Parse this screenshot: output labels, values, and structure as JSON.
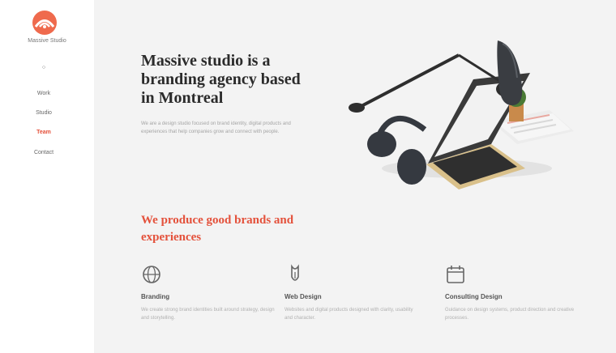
{
  "sidebar": {
    "brand": "Massive Studio",
    "nav": [
      {
        "label": "",
        "active": false
      },
      {
        "label": "Work",
        "active": false
      },
      {
        "label": "Studio",
        "active": false
      },
      {
        "label": "Team",
        "active": true
      },
      {
        "label": "Contact",
        "active": false
      }
    ],
    "accent_color": "#e4513b"
  },
  "hero": {
    "title": "Massive studio is a branding agency based in Montreal",
    "description": "We are a design studio focused on brand identity, digital products and experiences that help companies grow and connect with people."
  },
  "tagline": "We produce good brands and experiences",
  "services": [
    {
      "icon": "globe-icon",
      "name": "Branding",
      "desc": "We create strong brand identities built around strategy, design and storytelling."
    },
    {
      "icon": "pen-icon",
      "name": "Web Design",
      "desc": "Websites and digital products designed with clarity, usability and character."
    },
    {
      "icon": "calendar-icon",
      "name": "Consulting Design",
      "desc": "Guidance on design systems, product direction and creative processes."
    }
  ]
}
